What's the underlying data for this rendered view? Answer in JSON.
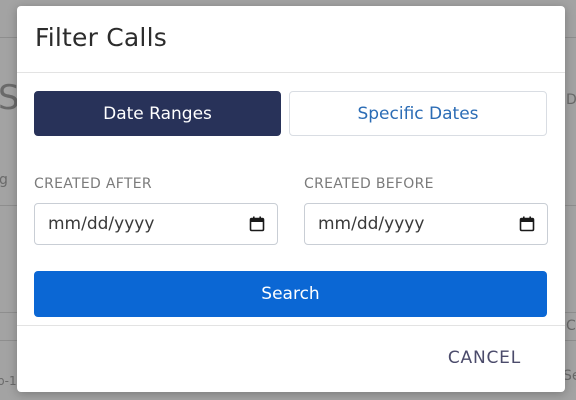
{
  "background": {
    "fragments": [
      "S",
      "g",
      "C",
      "D",
      "b-1",
      "Se"
    ]
  },
  "modal": {
    "title": "Filter Calls",
    "tabs": [
      {
        "label": "Date Ranges",
        "active": true
      },
      {
        "label": "Specific Dates",
        "active": false
      }
    ],
    "fields": {
      "created_after": {
        "label": "CREATED AFTER",
        "placeholder": "mm/dd/yyyy",
        "icon": "calendar-icon"
      },
      "created_before": {
        "label": "CREATED BEFORE",
        "placeholder": "mm/dd/yyyy",
        "icon": "calendar-icon"
      }
    },
    "search_label": "Search",
    "cancel_label": "CANCEL"
  },
  "colors": {
    "tab_active_bg": "#283259",
    "tab_inactive_text": "#2b6cb5",
    "search_bg": "#0b67d4",
    "overlay": "#a3a3a3"
  }
}
